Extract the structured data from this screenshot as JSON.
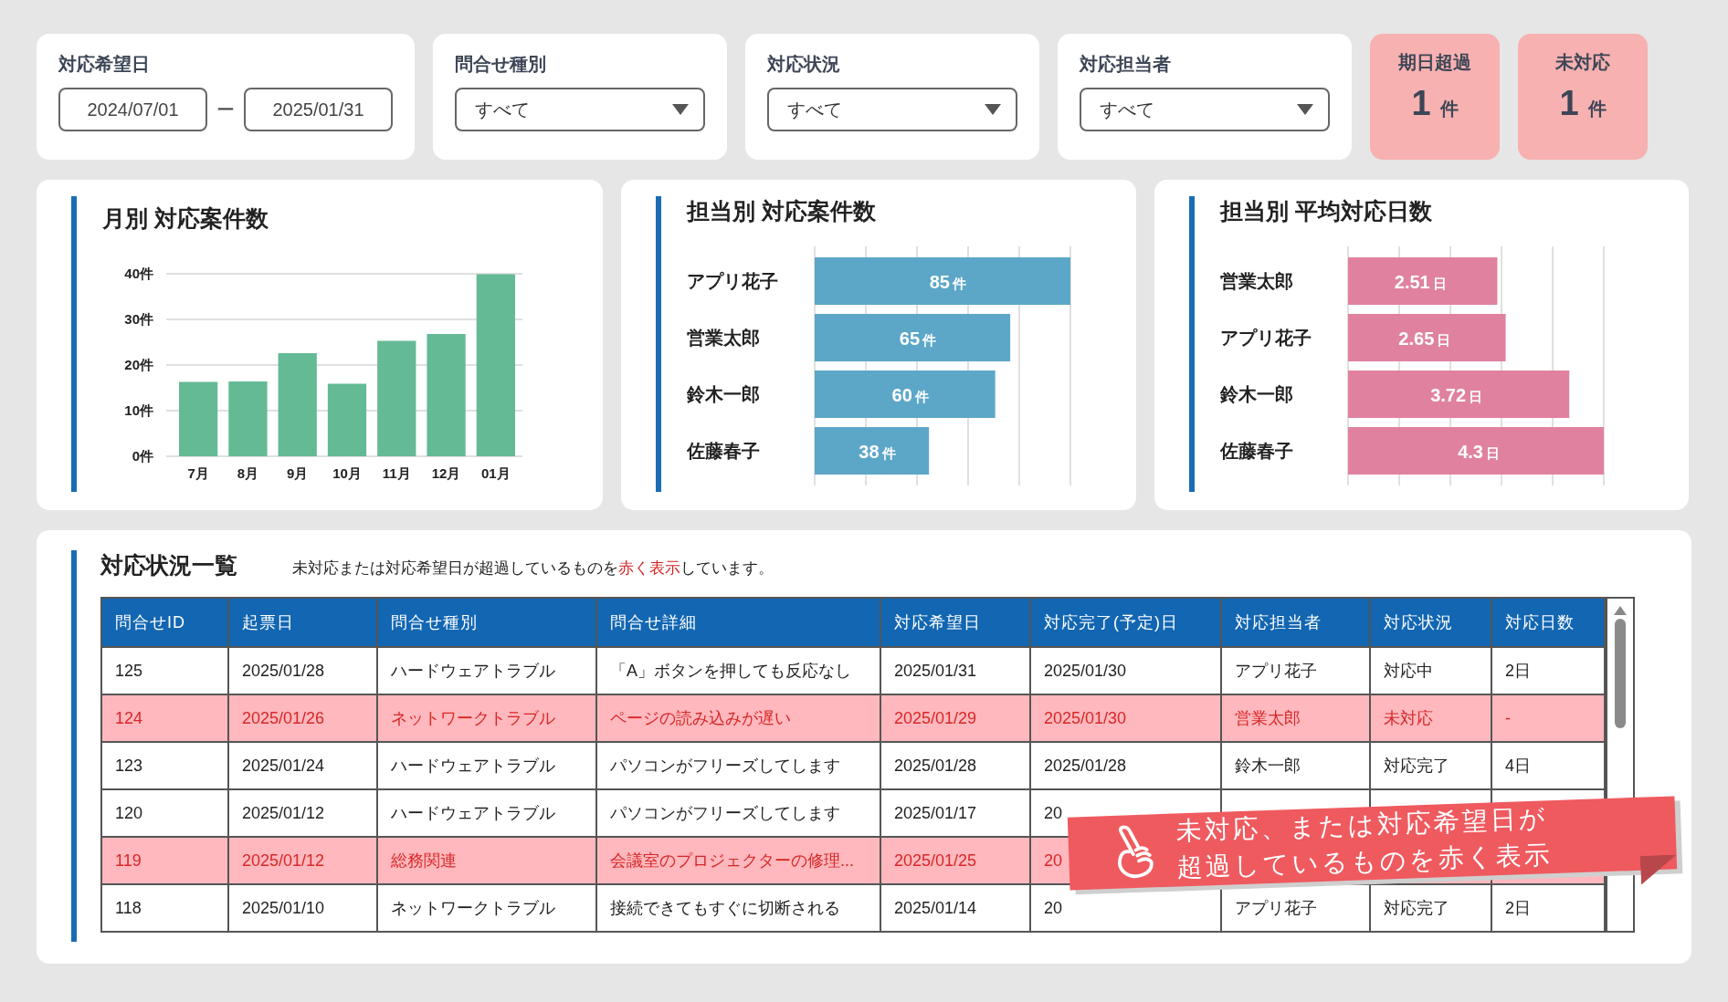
{
  "filters": [
    {
      "kind": "daterange",
      "label": "対応希望日",
      "from": "2024/07/01",
      "separator": "ー",
      "to": "2025/01/31"
    },
    {
      "kind": "select",
      "label": "問合せ種別",
      "value": "すべて"
    },
    {
      "kind": "select",
      "label": "対応状況",
      "value": "すべて"
    },
    {
      "kind": "select",
      "label": "対応担当者",
      "value": "すべて"
    }
  ],
  "counters": [
    {
      "label": "期日超過",
      "count": "1",
      "unit": "件"
    },
    {
      "label": "未対応",
      "count": "1",
      "unit": "件"
    }
  ],
  "charts": [
    {
      "title": "月別 対応案件数",
      "chart_data": {
        "type": "bar",
        "grid": true,
        "categories": [
          "7月",
          "8月",
          "9月",
          "10月",
          "11月",
          "12月",
          "01月"
        ],
        "ylim": [
          0,
          40
        ],
        "yticks": [
          {
            "value": 0,
            "label": "0件"
          },
          {
            "value": 10,
            "label": "10件"
          },
          {
            "value": 20,
            "label": "20件"
          },
          {
            "value": 30,
            "label": "30件"
          },
          {
            "value": 40,
            "label": "40件"
          }
        ],
        "series": [
          {
            "color": "#64ba95",
            "values": [
              16.3,
              16.4,
              22.6,
              15.9,
              25.3,
              26.8,
              39.9
            ]
          }
        ]
      }
    },
    {
      "title": "担当別 対応案件数",
      "chart_data": {
        "type": "bar",
        "orientation": "horizontal",
        "categories": [
          "アプリ花子",
          "営業太郎",
          "鈴木一郎",
          "佐藤春子"
        ],
        "series": [
          {
            "color": "#5ca7c8",
            "values": [
              85,
              65,
              60,
              38
            ]
          }
        ],
        "data_labels": true,
        "value_labels": [
          "85件",
          "65件",
          "60件",
          "38件"
        ]
      }
    },
    {
      "title": "担当別 平均対応日数",
      "chart_data": {
        "type": "bar",
        "orientation": "horizontal",
        "categories": [
          "営業太郎",
          "アプリ花子",
          "鈴木一郎",
          "佐藤春子"
        ],
        "series": [
          {
            "color": "#e0829f",
            "values": [
              2.51,
              2.65,
              3.72,
              4.3
            ]
          }
        ],
        "data_labels": true,
        "value_labels": [
          "2.51日",
          "2.65日",
          "3.72日",
          "4.3日"
        ]
      }
    }
  ],
  "table": {
    "title": "対応状況一覧",
    "note": "未対応または対応希望日が超過しているものを**赤く表示**しています。",
    "columns": [
      "問合せID",
      "起票日",
      "問合せ種別",
      "問合せ詳細",
      "対応希望日",
      "対応完了(予定)日",
      "対応担当者",
      "対応状況",
      "対応日数"
    ],
    "rows": [
      {
        "highlighted": false,
        "cells": [
          "125",
          "2025/01/28",
          "ハードウェアトラブル",
          "「A」ボタンを押しても反応なし",
          "2025/01/31",
          "2025/01/30",
          "アプリ花子",
          "対応中",
          "2日"
        ]
      },
      {
        "highlighted": true,
        "cells": [
          "124",
          "2025/01/26",
          "ネットワークトラブル",
          "ページの読み込みが遅い",
          "2025/01/29",
          "2025/01/30",
          "営業太郎",
          "未対応",
          "-"
        ]
      },
      {
        "highlighted": false,
        "cells": [
          "123",
          "2025/01/24",
          "ハードウェアトラブル",
          "パソコンがフリーズしてします",
          "2025/01/28",
          "2025/01/28",
          "鈴木一郎",
          "対応完了",
          "4日"
        ]
      },
      {
        "highlighted": false,
        "cells": [
          "120",
          "2025/01/12",
          "ハードウェアトラブル",
          "パソコンがフリーズしてします",
          "2025/01/17",
          "20",
          null,
          null,
          null
        ]
      },
      {
        "highlighted": true,
        "cells": [
          "119",
          "2025/01/12",
          "総務関連",
          "会議室のプロジェクターの修理...",
          "2025/01/25",
          "20",
          null,
          null,
          null
        ]
      },
      {
        "highlighted": false,
        "cells": [
          "118",
          "2025/01/10",
          "ネットワークトラブル",
          "接続できてもすぐに切断される",
          "2025/01/14",
          "20",
          "アプリ花子",
          "対応完了",
          "2日"
        ]
      }
    ]
  },
  "callout": {
    "lines": [
      "未対応、または対応希望日が",
      "超過しているものを赤く表示"
    ]
  }
}
